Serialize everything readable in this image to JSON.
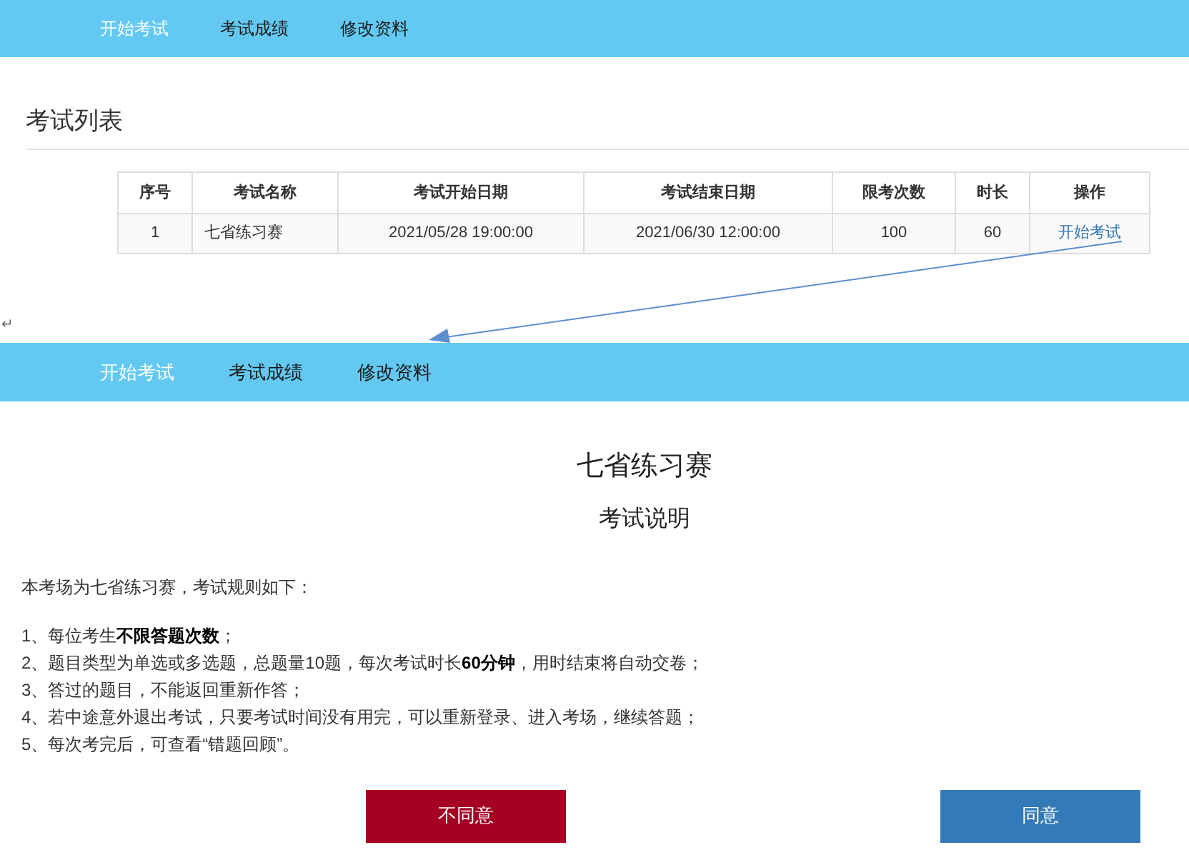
{
  "top_nav": {
    "tabs": [
      {
        "label": "开始考试",
        "selected": true
      },
      {
        "label": "考试成绩",
        "selected": false
      },
      {
        "label": "修改资料",
        "selected": false
      }
    ]
  },
  "heading": "考试列表",
  "table": {
    "columns": [
      "序号",
      "考试名称",
      "考试开始日期",
      "考试结束日期",
      "限考次数",
      "时长",
      "操作"
    ],
    "rows": [
      {
        "cells": [
          "1",
          "七省练习赛",
          "2021/05/28 19:00:00",
          "2021/06/30 12:00:00",
          "100",
          "60"
        ],
        "action": "开始考试"
      }
    ]
  },
  "return_mark": "↵",
  "bottom_nav": {
    "tabs": [
      {
        "label": "开始考试",
        "selected": true
      },
      {
        "label": "考试成绩",
        "selected": false
      },
      {
        "label": "修改资料",
        "selected": false
      }
    ]
  },
  "exam_title": "七省练习赛",
  "exam_subtitle": "考试说明",
  "intro": "本考场为七省练习赛，考试规则如下：",
  "rules": [
    "1、每位考生**不限答题次数**；",
    "2、题目类型为单选或多选题，总题量10题，每次考试时长**60分钟**，用时结束将自动交卷；",
    "3、答过的题目，不能返回重新作答；",
    "4、若中途意外退出考试，只要考试时间没有用完，可以重新登录、进入考场，继续答题；",
    "5、每次考完后，可查看“错题回顾”。"
  ],
  "buttons": [
    {
      "label": "不同意",
      "kind": "decline"
    },
    {
      "label": "同意",
      "kind": "accept"
    }
  ]
}
